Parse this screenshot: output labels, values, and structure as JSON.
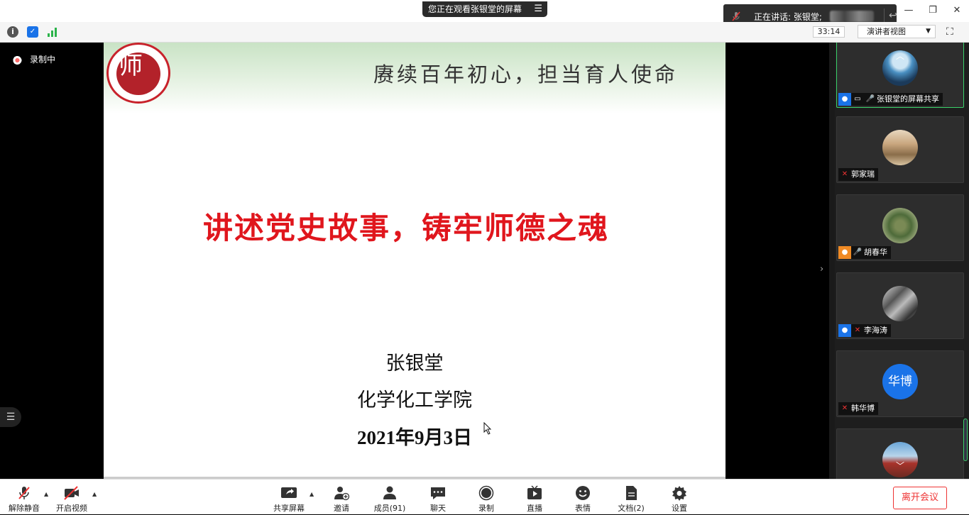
{
  "share_banner": {
    "label": "您正在观看张银堂的屏幕"
  },
  "speaker_bar": {
    "label": "正在讲话: 张银堂;"
  },
  "toolbar": {
    "timer": "33:14",
    "view_label": "演讲者视图"
  },
  "left_pane": {
    "recording_label": "录制中"
  },
  "slide": {
    "motto": "赓续百年初心，担当育人使命",
    "title": "讲述党史故事，铸牢师德之魂",
    "author": "张银堂",
    "department": "化学化工学院",
    "date": "2021年9月3日"
  },
  "gallery": {
    "tiles": [
      {
        "name": "张银堂的屏幕共享"
      },
      {
        "name": "郭家瑞"
      },
      {
        "name": "胡春华"
      },
      {
        "name": "李海涛"
      },
      {
        "name": "韩华博",
        "avatar_text": "华博"
      },
      {
        "name": ""
      }
    ]
  },
  "bottom_bar": {
    "unmute": "解除静音",
    "start_video": "开启视频",
    "share_screen": "共享屏幕",
    "invite": "邀请",
    "members": "成员(91)",
    "chat": "聊天",
    "record": "录制",
    "live": "直播",
    "reactions": "表情",
    "docs": "文档(2)",
    "settings": "设置",
    "leave": "离开会议"
  },
  "colors": {
    "accent": "#1a73e8",
    "active_border": "#3ad16a",
    "danger": "#e33333",
    "title_red": "#e0161d"
  }
}
